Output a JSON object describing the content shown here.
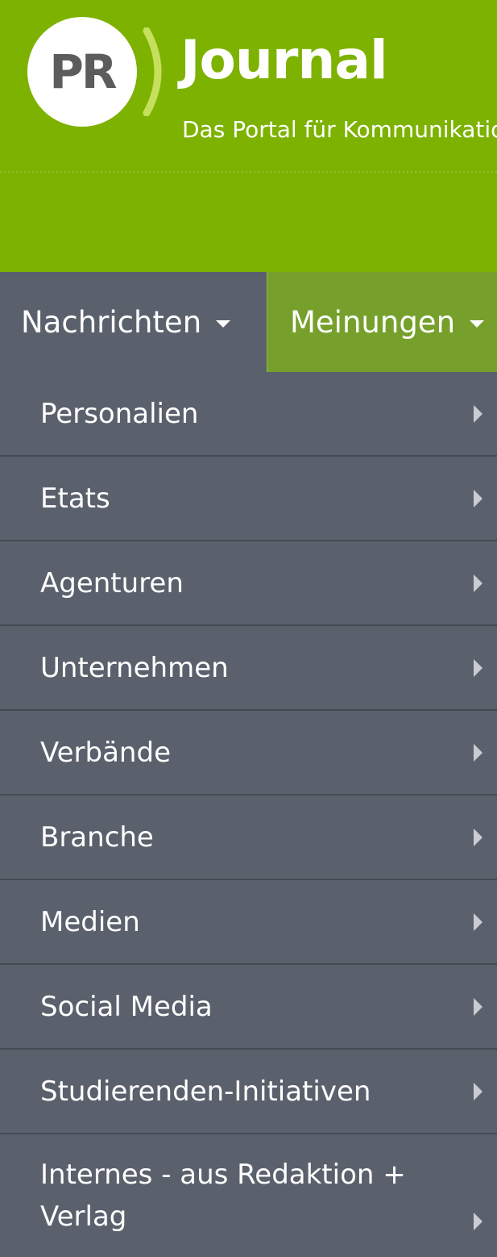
{
  "header": {
    "logo_text": "PR",
    "title": "Journal",
    "tagline": "Das Portal für Kommunikation",
    "background_color": "#7db200",
    "arc_color": "#c6e05e"
  },
  "topnav": {
    "items": [
      {
        "label": "Nachrichten",
        "background": "#5b616c"
      },
      {
        "label": "Meinungen",
        "background": "#76a02b"
      }
    ]
  },
  "submenu": {
    "items": [
      {
        "label": "Personalien"
      },
      {
        "label": "Etats"
      },
      {
        "label": "Agenturen"
      },
      {
        "label": "Unternehmen"
      },
      {
        "label": "Verbände"
      },
      {
        "label": "Branche"
      },
      {
        "label": "Medien"
      },
      {
        "label": "Social Media"
      },
      {
        "label": "Studierenden-Initiativen"
      },
      {
        "label": "Internes - aus Redaktion + Verlag"
      }
    ],
    "background_color": "#5b616c",
    "divider_color": "#454a53"
  }
}
